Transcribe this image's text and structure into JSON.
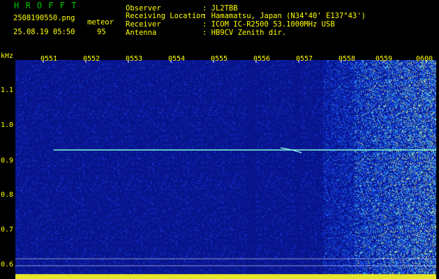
{
  "header": {
    "program": "H R O F F T",
    "filename": "2508190550.png",
    "datetime": "25.08.19 05:50",
    "mode_label": "meteor",
    "mode_value": "95",
    "observer_label": "Observer",
    "observer_value": ": JL2TBB",
    "location_label": "Receiving Location",
    "location_value": ": Hamamatsu, Japan (N34°40' E137°43')",
    "receiver_label": "Receiver",
    "receiver_value": ": ICOM IC-R2500 53.1000MHz USB",
    "antenna_label": "Antenna",
    "antenna_value": ": HB9CV Zenith dir."
  },
  "axis": {
    "unit": "kHz",
    "y_ticks": [
      "1.1",
      "1.0",
      "0.9",
      "0.8",
      "0.7",
      "0.6"
    ],
    "x_ticks": [
      "0551",
      "0552",
      "0553",
      "0554",
      "0555",
      "0556",
      "0557",
      "0558",
      "0559",
      "0600"
    ]
  },
  "colors": {
    "background": "#000000",
    "text": "#ffff00",
    "title": "#00c800",
    "plot_base": "#0a1a8c",
    "trace": "#7fffd4"
  }
}
